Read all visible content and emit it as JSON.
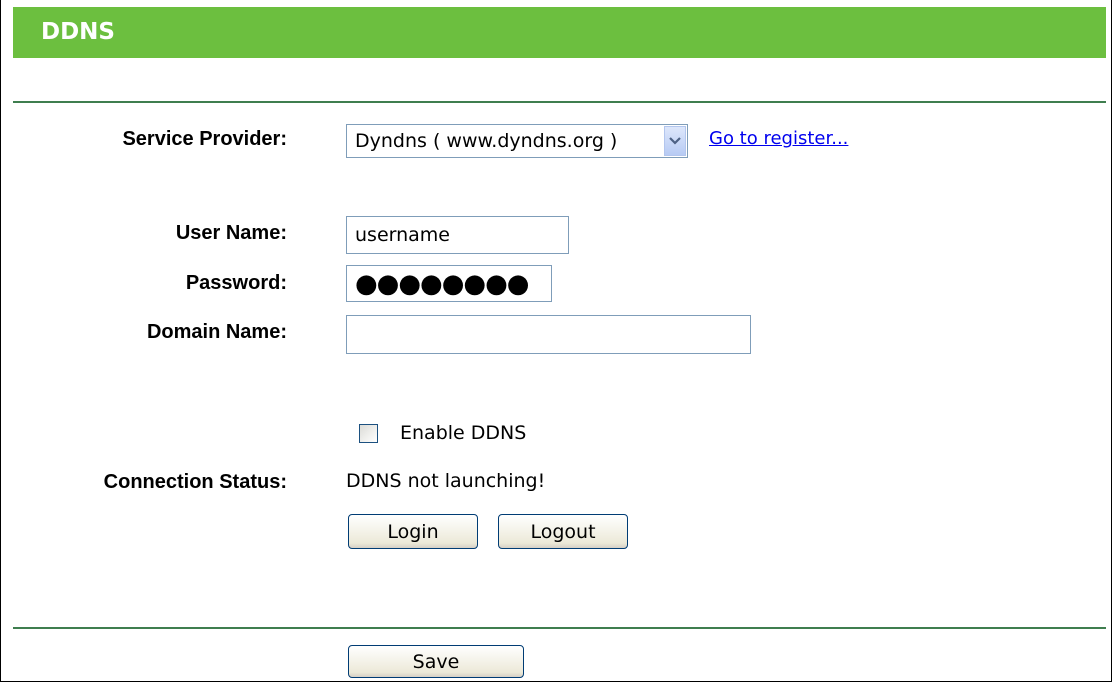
{
  "header": {
    "title": "DDNS"
  },
  "form": {
    "service_provider_label": "Service Provider:",
    "service_provider_value": "Dyndns ( www.dyndns.org )",
    "register_link": "Go to register...",
    "user_name_label": "User Name:",
    "user_name_value": "username",
    "password_label": "Password:",
    "password_value": "●●●●●●●●",
    "domain_name_label": "Domain Name:",
    "domain_name_value": "",
    "enable_ddns_label": "Enable DDNS",
    "enable_ddns_checked": false,
    "connection_status_label": "Connection Status:",
    "connection_status_value": "DDNS not launching!"
  },
  "buttons": {
    "login": "Login",
    "logout": "Logout",
    "save": "Save"
  },
  "colors": {
    "title_bar": "#6cbf3f",
    "divider": "#3f7e4f",
    "link": "#0000ee"
  },
  "icons": {
    "dropdown": "chevron-down-icon"
  }
}
